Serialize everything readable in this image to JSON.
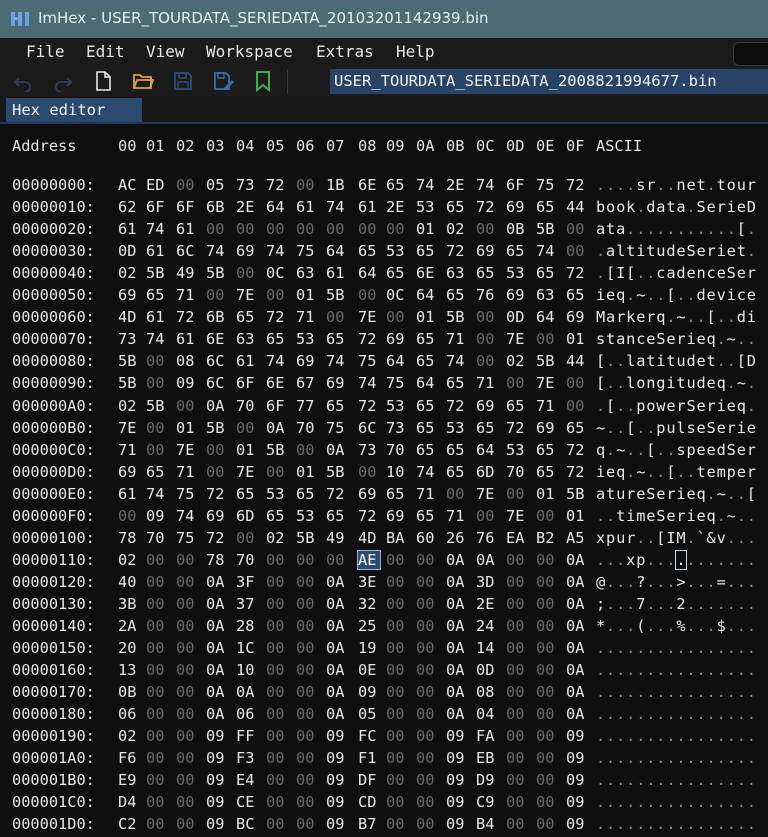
{
  "window": {
    "title": "ImHex - USER_TOURDATA_SERIEDATA_20103201142939.bin"
  },
  "menu": [
    "File",
    "Edit",
    "View",
    "Workspace",
    "Extras",
    "Help"
  ],
  "toolbar": {
    "icons": [
      "undo-icon",
      "redo-icon",
      "new-file-icon",
      "open-folder-icon",
      "save-icon",
      "save-as-icon",
      "bookmark-icon"
    ],
    "file_tab": "USER_TOURDATA_SERIEDATA_2008821994677.bin"
  },
  "tabs": [
    "Hex editor"
  ],
  "editor": {
    "header": {
      "address_label": "Address",
      "columns": [
        "00",
        "01",
        "02",
        "03",
        "04",
        "05",
        "06",
        "07",
        "08",
        "09",
        "0A",
        "0B",
        "0C",
        "0D",
        "0E",
        "0F"
      ],
      "ascii_label": "ASCII"
    },
    "selected": {
      "row": 17,
      "col": 8
    },
    "rows": [
      {
        "address": "00000000:",
        "bytes": "AC ED 00 05 73 72 00 1B 6E 65 74 2E 74 6F 75 72",
        "ascii": "....sr..net.tour"
      },
      {
        "address": "00000010:",
        "bytes": "62 6F 6F 6B 2E 64 61 74 61 2E 53 65 72 69 65 44",
        "ascii": "book.data.SerieD"
      },
      {
        "address": "00000020:",
        "bytes": "61 74 61 00 00 00 00 00 00 00 01 02 00 0B 5B 00",
        "ascii": "ata...........[."
      },
      {
        "address": "00000030:",
        "bytes": "0D 61 6C 74 69 74 75 64 65 53 65 72 69 65 74 00",
        "ascii": ".altitudeSeriet."
      },
      {
        "address": "00000040:",
        "bytes": "02 5B 49 5B 00 0C 63 61 64 65 6E 63 65 53 65 72",
        "ascii": ".[I[..cadenceSer"
      },
      {
        "address": "00000050:",
        "bytes": "69 65 71 00 7E 00 01 5B 00 0C 64 65 76 69 63 65",
        "ascii": "ieq.~..[..device"
      },
      {
        "address": "00000060:",
        "bytes": "4D 61 72 6B 65 72 71 00 7E 00 01 5B 00 0D 64 69",
        "ascii": "Markerq.~..[..di"
      },
      {
        "address": "00000070:",
        "bytes": "73 74 61 6E 63 65 53 65 72 69 65 71 00 7E 00 01",
        "ascii": "stanceSerieq.~.."
      },
      {
        "address": "00000080:",
        "bytes": "5B 00 08 6C 61 74 69 74 75 64 65 74 00 02 5B 44",
        "ascii": "[..latitudet..[D"
      },
      {
        "address": "00000090:",
        "bytes": "5B 00 09 6C 6F 6E 67 69 74 75 64 65 71 00 7E 00",
        "ascii": "[..longitudeq.~."
      },
      {
        "address": "000000A0:",
        "bytes": "02 5B 00 0A 70 6F 77 65 72 53 65 72 69 65 71 00",
        "ascii": ".[..powerSerieq."
      },
      {
        "address": "000000B0:",
        "bytes": "7E 00 01 5B 00 0A 70 75 6C 73 65 53 65 72 69 65",
        "ascii": "~..[..pulseSerie"
      },
      {
        "address": "000000C0:",
        "bytes": "71 00 7E 00 01 5B 00 0A 73 70 65 65 64 53 65 72",
        "ascii": "q.~..[..speedSer"
      },
      {
        "address": "000000D0:",
        "bytes": "69 65 71 00 7E 00 01 5B 00 10 74 65 6D 70 65 72",
        "ascii": "ieq.~..[..temper"
      },
      {
        "address": "000000E0:",
        "bytes": "61 74 75 72 65 53 65 72 69 65 71 00 7E 00 01 5B",
        "ascii": "atureSerieq.~..["
      },
      {
        "address": "000000F0:",
        "bytes": "00 09 74 69 6D 65 53 65 72 69 65 71 00 7E 00 01",
        "ascii": "..timeSerieq.~.."
      },
      {
        "address": "00000100:",
        "bytes": "78 70 75 72 00 02 5B 49 4D BA 60 26 76 EA B2 A5",
        "ascii": "xpur..[IM.`&v..."
      },
      {
        "address": "00000110:",
        "bytes": "02 00 00 78 70 00 00 00 AE 00 00 0A 0A 00 00 0A",
        "ascii": "...xp..........."
      },
      {
        "address": "00000120:",
        "bytes": "40 00 00 0A 3F 00 00 0A 3E 00 00 0A 3D 00 00 0A",
        "ascii": "@...?...>...=..."
      },
      {
        "address": "00000130:",
        "bytes": "3B 00 00 0A 37 00 00 0A 32 00 00 0A 2E 00 00 0A",
        "ascii": ";...7...2......."
      },
      {
        "address": "00000140:",
        "bytes": "2A 00 00 0A 28 00 00 0A 25 00 00 0A 24 00 00 0A",
        "ascii": "*...(...%...$..."
      },
      {
        "address": "00000150:",
        "bytes": "20 00 00 0A 1C 00 00 0A 19 00 00 0A 14 00 00 0A",
        "ascii": "................"
      },
      {
        "address": "00000160:",
        "bytes": "13 00 00 0A 10 00 00 0A 0E 00 00 0A 0D 00 00 0A",
        "ascii": "................"
      },
      {
        "address": "00000170:",
        "bytes": "0B 00 00 0A 0A 00 00 0A 09 00 00 0A 08 00 00 0A",
        "ascii": "................"
      },
      {
        "address": "00000180:",
        "bytes": "06 00 00 0A 06 00 00 0A 05 00 00 0A 04 00 00 0A",
        "ascii": "................"
      },
      {
        "address": "00000190:",
        "bytes": "02 00 00 09 FF 00 00 09 FC 00 00 09 FA 00 00 09",
        "ascii": "................"
      },
      {
        "address": "000001A0:",
        "bytes": "F6 00 00 09 F3 00 00 09 F1 00 00 09 EB 00 00 09",
        "ascii": "................"
      },
      {
        "address": "000001B0:",
        "bytes": "E9 00 00 09 E4 00 00 09 DF 00 00 09 D9 00 00 09",
        "ascii": "................"
      },
      {
        "address": "000001C0:",
        "bytes": "D4 00 00 09 CE 00 00 09 CD 00 00 09 C9 00 00 09",
        "ascii": "................"
      },
      {
        "address": "000001D0:",
        "bytes": "C2 00 00 09 BC 00 00 09 B7 00 00 09 B4 00 00 09",
        "ascii": "................"
      }
    ]
  }
}
